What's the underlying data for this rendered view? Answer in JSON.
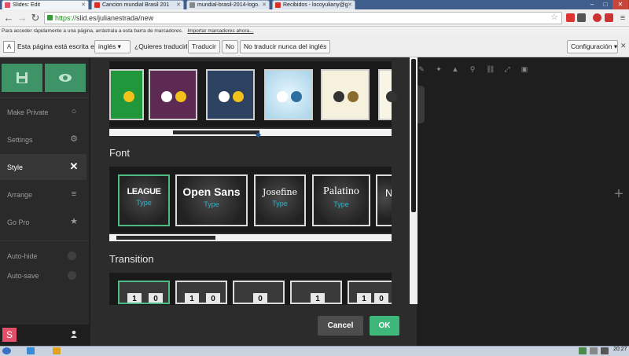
{
  "browser": {
    "tabs": [
      {
        "title": "Slides: Edit",
        "active": true,
        "favicon_color": "#e14f68"
      },
      {
        "title": "Cancion mundial Brasil 201",
        "active": false,
        "favicon_color": "#d93025"
      },
      {
        "title": "mundial-brasil-2014-logo.",
        "active": false,
        "favicon_color": "#888888"
      },
      {
        "title": "Recibidos - locoyuliany@g",
        "active": false,
        "favicon_color": "#d93025"
      }
    ],
    "window_controls": [
      "–",
      "□",
      "✕"
    ],
    "url_scheme": "https://",
    "url_rest": "slid.es/julianestrada/new",
    "bookmarks_hint": "Para acceder rápidamente a una página, arrástrala a esta barra de marcadores.",
    "bookmarks_link": "Importar marcadores ahora..."
  },
  "translate_bar": {
    "icon_text": "A",
    "text_before": "Esta página está escrita en",
    "language": "inglés",
    "question": "¿Quieres traducirla?",
    "translate_button": "Traducir",
    "no_button": "No",
    "never_button": "No traducir nunca del inglés",
    "settings_button": "Configuración"
  },
  "sidebar": {
    "items": [
      {
        "label": "Make Private",
        "icon": "lock-icon",
        "glyph": "🔒"
      },
      {
        "label": "Settings",
        "icon": "gear-icon",
        "glyph": "⚙"
      },
      {
        "label": "Style",
        "icon": "close-icon",
        "glyph": "✕",
        "active": true
      },
      {
        "label": "Arrange",
        "icon": "layers-icon",
        "glyph": "≡"
      },
      {
        "label": "Go Pro",
        "icon": "star-icon",
        "glyph": "★"
      }
    ],
    "toggles": [
      {
        "label": "Auto-hide"
      },
      {
        "label": "Auto-save"
      }
    ],
    "logo": "S",
    "user_glyph": "👤"
  },
  "panel": {
    "font_title": "Font",
    "transition_title": "Transition",
    "fonts": [
      {
        "name": "LEAGUE",
        "type": "Type",
        "selected": true
      },
      {
        "name": "Open Sans",
        "type": "Type",
        "selected": false
      },
      {
        "name": "Josefine",
        "type": "Type",
        "selected": false
      },
      {
        "name": "Palatino",
        "type": "Type",
        "selected": false
      },
      {
        "name": "N",
        "type": "",
        "selected": false
      }
    ],
    "transitions": [
      {
        "left": "1",
        "right": "0"
      },
      {
        "left": "1",
        "right": "0"
      },
      {
        "left": "0",
        "right": ""
      },
      {
        "left": "1",
        "right": ""
      },
      {
        "left": "1",
        "right": "0"
      }
    ],
    "themes": [
      {
        "bg": "#21973b",
        "dot1": "#ffffff",
        "dot2": "#f2c21b"
      },
      {
        "bg": "#5c2a52",
        "dot1": "#ffffff",
        "dot2": "#f2c21b"
      },
      {
        "bg": "#2d4160",
        "dot1": "#ffffff",
        "dot2": "#f2c21b"
      },
      {
        "bg": "#bfe0f0",
        "dot1": "#ffffff",
        "dot2": "#2d6f9e"
      },
      {
        "bg": "#f6f1dc",
        "dot1": "#333333",
        "dot2": "#8a6d2e"
      },
      {
        "bg": "#f8f5e6",
        "dot1": "#333333",
        "dot2": "#333333"
      }
    ],
    "cancel_label": "Cancel",
    "ok_label": "OK"
  },
  "canvas_tools": [
    "✎",
    "✦",
    "▲",
    "⚲",
    "⛓",
    "⤢",
    "▣"
  ],
  "taskbar": {
    "clock": "20:27"
  },
  "colors": {
    "accent_green": "#3db87a",
    "sidebar_bg": "#2a2a2a",
    "brand_pink": "#e14f68"
  }
}
